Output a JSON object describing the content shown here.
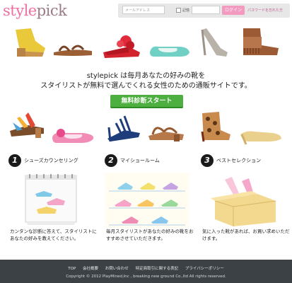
{
  "header": {
    "logo_part1": "style",
    "logo_part2": "pick",
    "mail_placeholder": "メールアドレス",
    "remember_label": "記憶",
    "login_label": "ログイン",
    "forgot_label": "パスワードを忘れた方"
  },
  "main": {
    "tagline_line1": "stylepick は毎月あなたの好みの靴を",
    "tagline_line2": "スタイリストが無料で選んでくれる女性のための通販サイトです。",
    "cta_label": "無料診断スタート"
  },
  "steps": [
    {
      "number": "1",
      "title": "シューズカウンセリング",
      "desc": "カンタンな診断に答えて、スタイリストにあなたの好みを教えてください。"
    },
    {
      "number": "2",
      "title": "マイショールーム",
      "desc": "毎月スタイリストがあなたの好みの靴をおすすめさせていただきます。"
    },
    {
      "number": "3",
      "title": "ベストセレクション",
      "desc": "気に入った靴があれば、お買い求めいただけます。"
    }
  ],
  "footer": {
    "links": [
      "TOP",
      "会社概要",
      "お問い合わせ",
      "特定商取引に関する表記",
      "プライバシーポリシー"
    ],
    "copyright": "Copyright © 2012 PlayMined,Inc , breaking new ground Co.,ltd All rights reserved."
  },
  "colors": {
    "brand_pink": "#f06fa2",
    "cta_green": "#4caf3f",
    "footer_bg": "#3b4145"
  }
}
